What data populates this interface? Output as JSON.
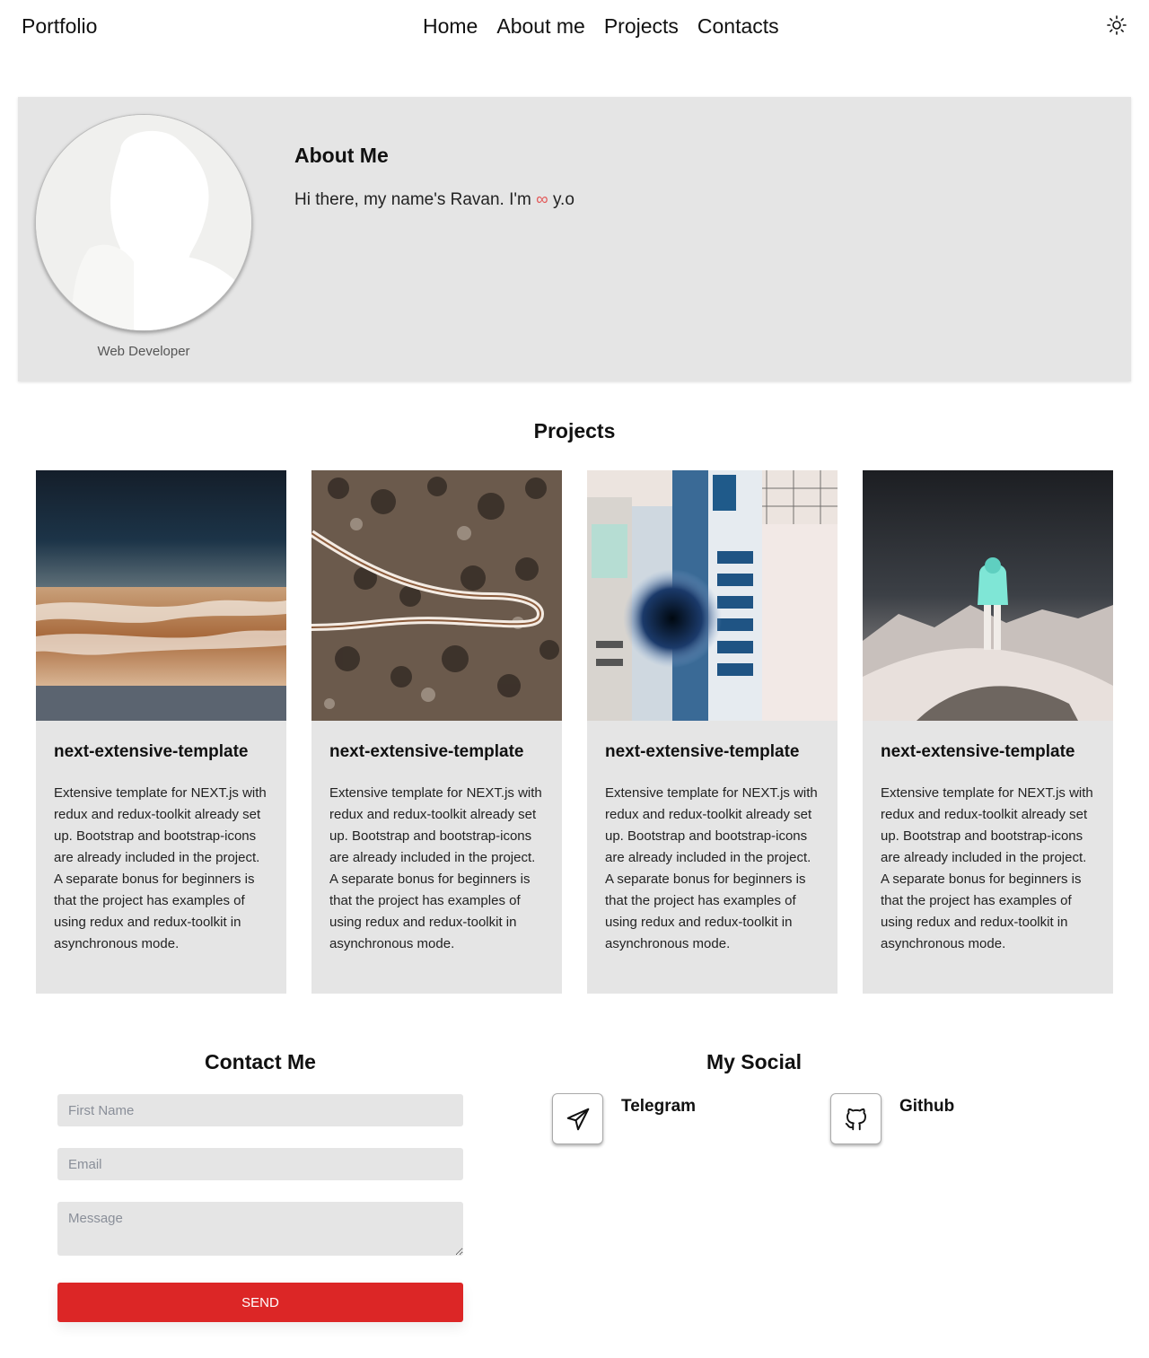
{
  "header": {
    "brand": "Portfolio",
    "nav": [
      "Home",
      "About me",
      "Projects",
      "Contacts"
    ],
    "theme_icon": "sun-icon"
  },
  "about": {
    "title": "About Me",
    "text_before": "Hi there, my name's Ravan. I'm ",
    "infinity": "∞",
    "text_after": " y.o",
    "role": "Web Developer",
    "accent": "#e35a5a"
  },
  "projects": {
    "title": "Projects",
    "cards": [
      {
        "title": "next-extensive-template",
        "description": "Extensive template for NEXT.js with redux and redux-toolkit already set up. Bootstrap and bootstrap-icons are already included in the project. A separate bonus for beginners is that the project has examples of using redux and redux-toolkit in asynchronous mode."
      },
      {
        "title": "next-extensive-template",
        "description": "Extensive template for NEXT.js with redux and redux-toolkit already set up. Bootstrap and bootstrap-icons are already included in the project. A separate bonus for beginners is that the project has examples of using redux and redux-toolkit in asynchronous mode."
      },
      {
        "title": "next-extensive-template",
        "description": "Extensive template for NEXT.js with redux and redux-toolkit already set up. Bootstrap and bootstrap-icons are already included in the project. A separate bonus for beginners is that the project has examples of using redux and redux-toolkit in asynchronous mode."
      },
      {
        "title": "next-extensive-template",
        "description": "Extensive template for NEXT.js with redux and redux-toolkit already set up. Bootstrap and bootstrap-icons are already included in the project. A separate bonus for beginners is that the project has examples of using redux and redux-toolkit in asynchronous mode."
      }
    ]
  },
  "contact": {
    "title": "Contact Me",
    "first_name_placeholder": "First Name",
    "email_placeholder": "Email",
    "message_placeholder": "Message",
    "send_label": "SEND",
    "button_color": "#dc2626"
  },
  "social": {
    "title": "My Social",
    "items": [
      {
        "label": "Telegram",
        "icon": "telegram-icon"
      },
      {
        "label": "Github",
        "icon": "github-icon"
      }
    ]
  }
}
